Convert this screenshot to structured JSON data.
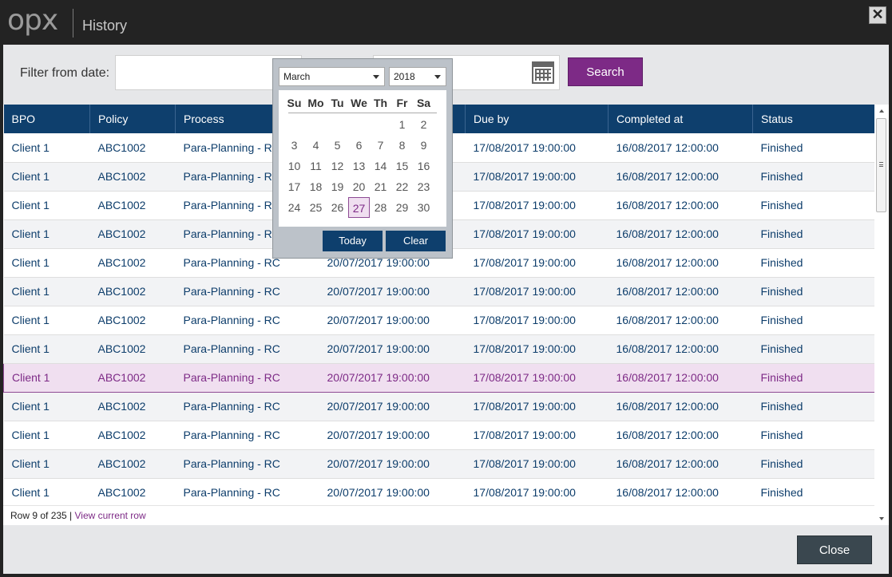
{
  "app": {
    "logo": "opx",
    "title": "History",
    "close_symbol": "✕"
  },
  "filter": {
    "label": "Filter from date:",
    "from_value": "",
    "to_value": "",
    "search_label": "Search"
  },
  "calendar": {
    "month": "March",
    "year": "2018",
    "weekdays": [
      "Su",
      "Mo",
      "Tu",
      "We",
      "Th",
      "Fr",
      "Sa"
    ],
    "weeks": [
      [
        "",
        "",
        "",
        "",
        "",
        "1",
        "2"
      ],
      [
        "3",
        "4",
        "5",
        "6",
        "7",
        "8",
        "9"
      ],
      [
        "10",
        "11",
        "12",
        "13",
        "14",
        "15",
        "16"
      ],
      [
        "17",
        "18",
        "19",
        "20",
        "21",
        "22",
        "23"
      ],
      [
        "24",
        "25",
        "26",
        "27",
        "28",
        "29",
        "30"
      ]
    ],
    "selected_day": "27",
    "today_label": "Today",
    "clear_label": "Clear"
  },
  "table": {
    "columns": [
      "BPO",
      "Policy",
      "Process",
      "",
      "Due by",
      "Completed at",
      "Status"
    ],
    "rows": [
      [
        "Client 1",
        "ABC1002",
        "Para-Planning - RC",
        "",
        "17/08/2017 19:00:00",
        "16/08/2017 12:00:00",
        "Finished"
      ],
      [
        "Client 1",
        "ABC1002",
        "Para-Planning - RC",
        "",
        "17/08/2017 19:00:00",
        "16/08/2017 12:00:00",
        "Finished"
      ],
      [
        "Client 1",
        "ABC1002",
        "Para-Planning - RC",
        "",
        "17/08/2017 19:00:00",
        "16/08/2017 12:00:00",
        "Finished"
      ],
      [
        "Client 1",
        "ABC1002",
        "Para-Planning - RC",
        "",
        "17/08/2017 19:00:00",
        "16/08/2017 12:00:00",
        "Finished"
      ],
      [
        "Client 1",
        "ABC1002",
        "Para-Planning - RC",
        "20/07/2017 19:00:00",
        "17/08/2017 19:00:00",
        "16/08/2017 12:00:00",
        "Finished"
      ],
      [
        "Client 1",
        "ABC1002",
        "Para-Planning - RC",
        "20/07/2017 19:00:00",
        "17/08/2017 19:00:00",
        "16/08/2017 12:00:00",
        "Finished"
      ],
      [
        "Client 1",
        "ABC1002",
        "Para-Planning - RC",
        "20/07/2017 19:00:00",
        "17/08/2017 19:00:00",
        "16/08/2017 12:00:00",
        "Finished"
      ],
      [
        "Client 1",
        "ABC1002",
        "Para-Planning - RC",
        "20/07/2017 19:00:00",
        "17/08/2017 19:00:00",
        "16/08/2017 12:00:00",
        "Finished"
      ],
      [
        "Client 1",
        "ABC1002",
        "Para-Planning - RC",
        "20/07/2017 19:00:00",
        "17/08/2017 19:00:00",
        "16/08/2017 12:00:00",
        "Finished"
      ],
      [
        "Client 1",
        "ABC1002",
        "Para-Planning - RC",
        "20/07/2017 19:00:00",
        "17/08/2017 19:00:00",
        "16/08/2017 12:00:00",
        "Finished"
      ],
      [
        "Client 1",
        "ABC1002",
        "Para-Planning - RC",
        "20/07/2017 19:00:00",
        "17/08/2017 19:00:00",
        "16/08/2017 12:00:00",
        "Finished"
      ],
      [
        "Client 1",
        "ABC1002",
        "Para-Planning - RC",
        "20/07/2017 19:00:00",
        "17/08/2017 19:00:00",
        "16/08/2017 12:00:00",
        "Finished"
      ],
      [
        "Client 1",
        "ABC1002",
        "Para-Planning - RC",
        "20/07/2017 19:00:00",
        "17/08/2017 19:00:00",
        "16/08/2017 12:00:00",
        "Finished"
      ]
    ],
    "selected_row": 9
  },
  "status": {
    "row_text": "Row 9 of 235 | ",
    "link_text": "View current row"
  },
  "footer": {
    "close_label": "Close"
  },
  "icons": {
    "calendar": "calendar-icon",
    "close": "close-icon",
    "dropdown": "chevron-down-icon"
  },
  "colors": {
    "header": "#0e3f6d",
    "accent": "#7d2a86",
    "selected_row": "#f0dff0",
    "close_button": "#3a474f"
  }
}
